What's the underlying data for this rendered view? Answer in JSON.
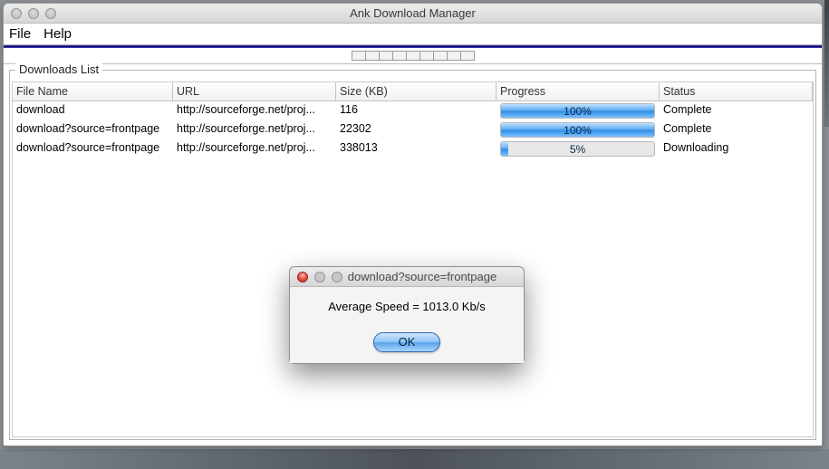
{
  "window": {
    "title": "Ank Download Manager"
  },
  "menu": {
    "file": "File",
    "help": "Help"
  },
  "group": {
    "title": "Downloads List"
  },
  "headers": {
    "file": "File Name",
    "url": "URL",
    "size": "Size (KB)",
    "progress": "Progress",
    "status": "Status"
  },
  "downloads": [
    {
      "file": "download",
      "url": "http://sourceforge.net/proj...",
      "size": "116",
      "progress": 100,
      "progress_label": "100%",
      "status": "Complete"
    },
    {
      "file": "download?source=frontpage",
      "url": "http://sourceforge.net/proj...",
      "size": "22302",
      "progress": 100,
      "progress_label": "100%",
      "status": "Complete"
    },
    {
      "file": "download?source=frontpage",
      "url": "http://sourceforge.net/proj...",
      "size": "338013",
      "progress": 5,
      "progress_label": "5%",
      "status": "Downloading"
    }
  ],
  "dialog": {
    "title": "download?source=frontpage",
    "message": "Average Speed = 1013.0 Kb/s",
    "ok": "OK"
  }
}
